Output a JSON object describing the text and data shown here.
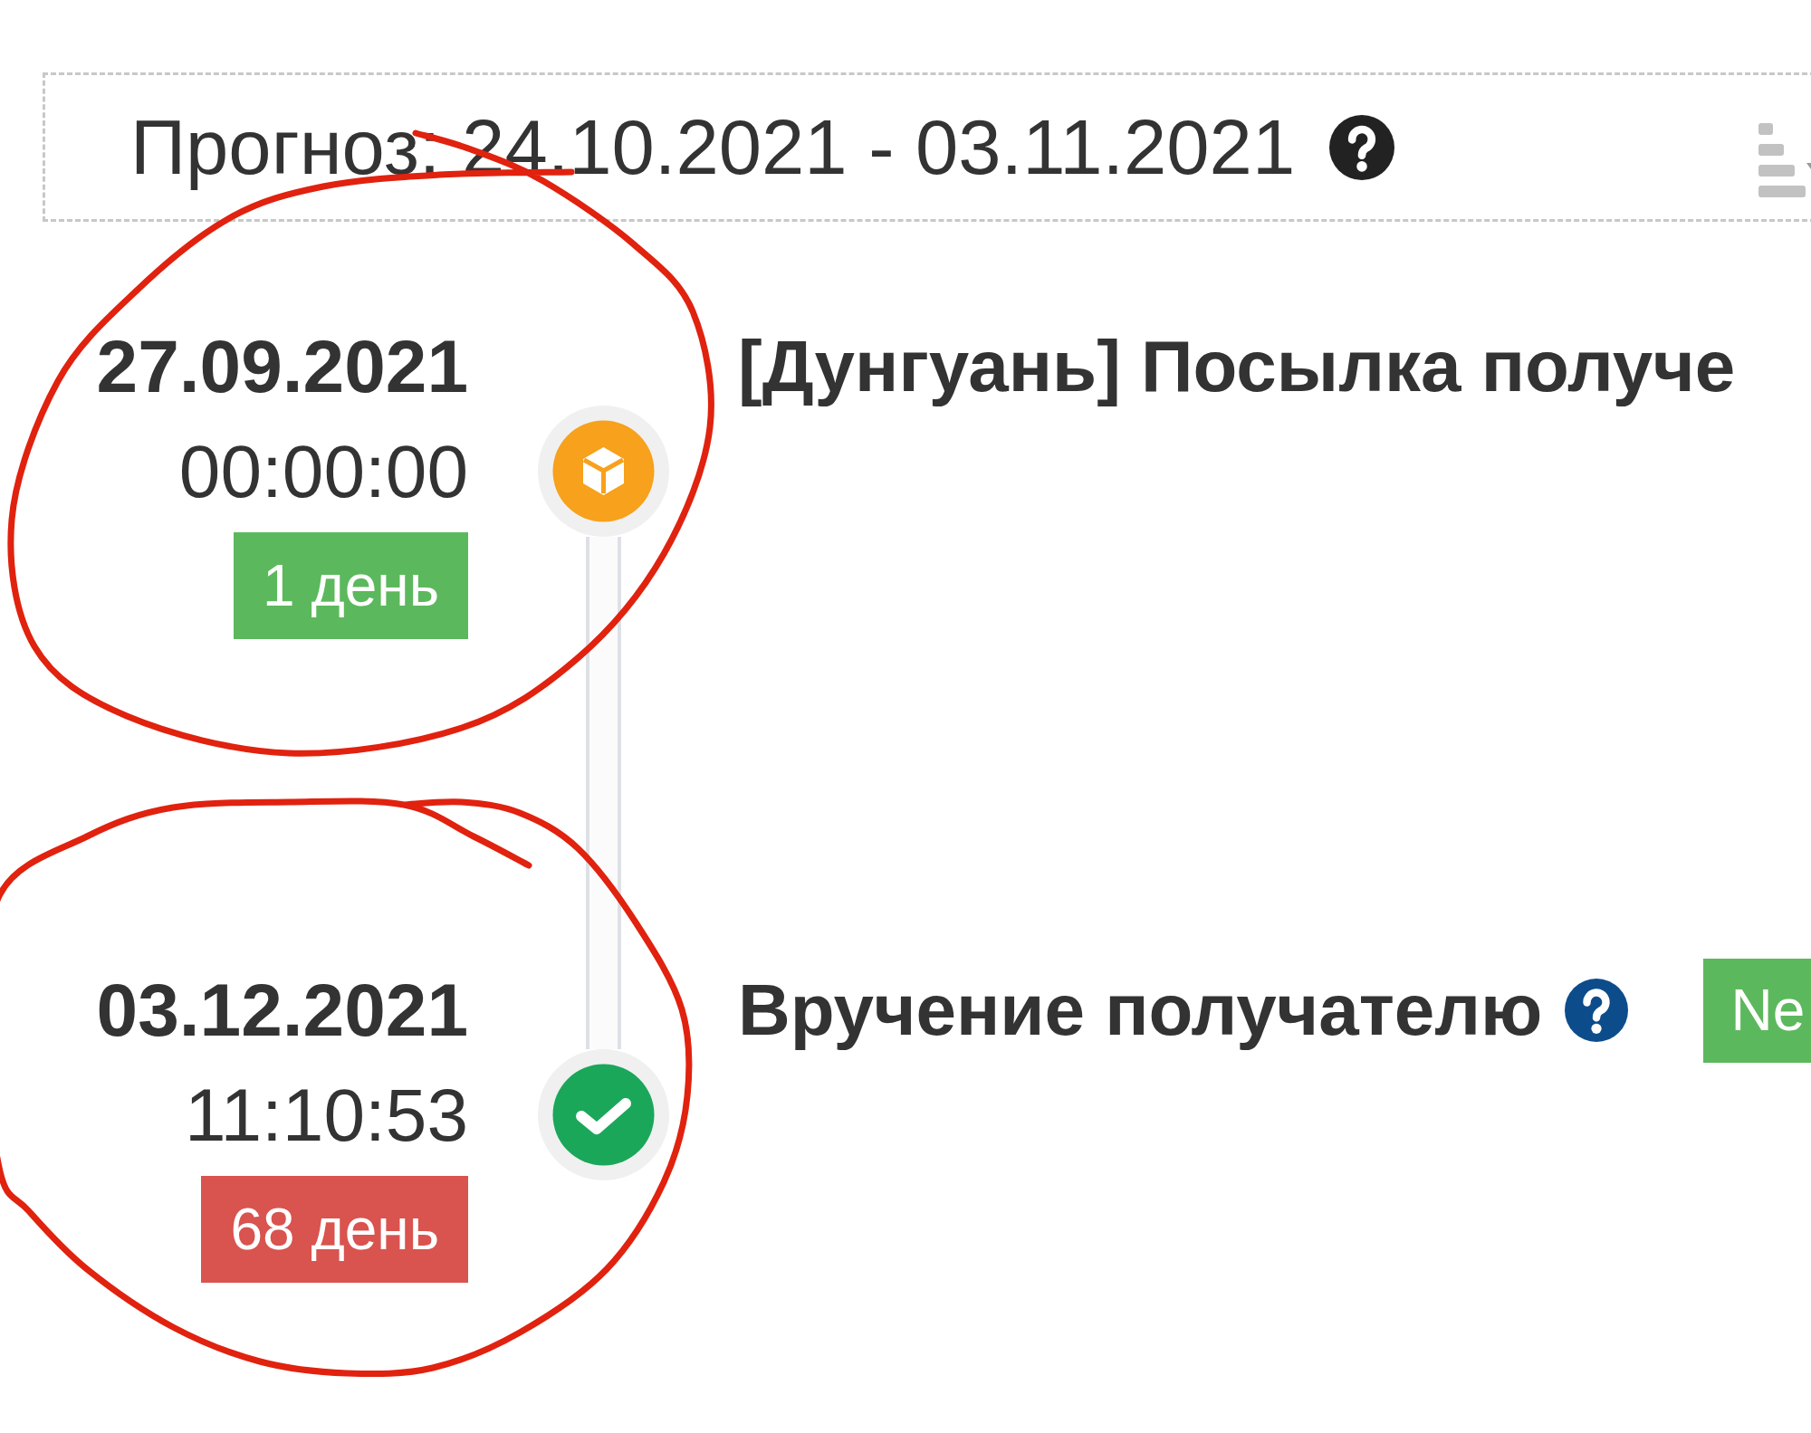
{
  "forecast": {
    "label": "Прогноз: 24.10.2021 - 03.11.2021",
    "has_help": true
  },
  "events": [
    {
      "date": "27.09.2021",
      "time": "00:00:00",
      "duration": {
        "text": "1 день",
        "color": "#5cb85c"
      },
      "kind": "parcel",
      "title": "[Дунгуань] Посылка получе",
      "has_help": false
    },
    {
      "date": "03.12.2021",
      "time": "11:10:53",
      "duration": {
        "text": "68 день",
        "color": "#d9534f"
      },
      "kind": "delivered",
      "title": "Вручение получателю",
      "has_help": true,
      "tag": "Ne"
    }
  ]
}
